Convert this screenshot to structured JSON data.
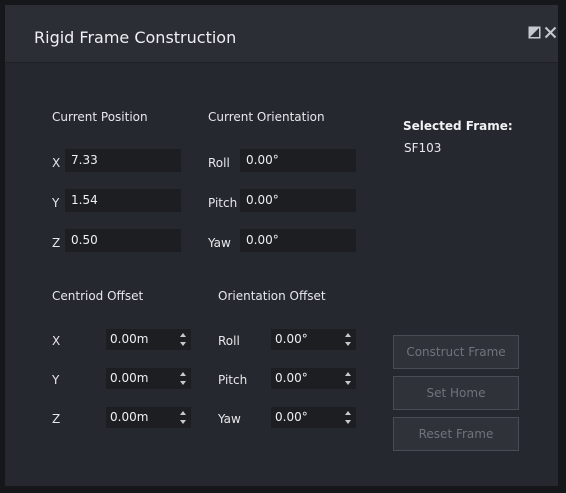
{
  "window": {
    "title": "Rigid Frame Construction",
    "icons": [
      "restore-icon",
      "close-icon"
    ]
  },
  "current_position": {
    "heading": "Current Position",
    "rows": [
      {
        "axis": "X",
        "value": "7.33"
      },
      {
        "axis": "Y",
        "value": "1.54"
      },
      {
        "axis": "Z",
        "value": "0.50"
      }
    ]
  },
  "current_orientation": {
    "heading": "Current Orientation",
    "rows": [
      {
        "axis": "Roll",
        "value": "0.00°"
      },
      {
        "axis": "Pitch",
        "value": "0.00°"
      },
      {
        "axis": "Yaw",
        "value": "0.00°"
      }
    ]
  },
  "selected_frame": {
    "label": "Selected Frame:",
    "value": "SF103"
  },
  "centroid_offset": {
    "heading": "Centriod Offset",
    "rows": [
      {
        "axis": "X",
        "value": "0.00m"
      },
      {
        "axis": "Y",
        "value": "0.00m"
      },
      {
        "axis": "Z",
        "value": "0.00m"
      }
    ]
  },
  "orientation_offset": {
    "heading": "Orientation Offset",
    "rows": [
      {
        "axis": "Roll",
        "value": "0.00°"
      },
      {
        "axis": "Pitch",
        "value": "0.00°"
      },
      {
        "axis": "Yaw",
        "value": "0.00°"
      }
    ]
  },
  "buttons": {
    "construct": "Construct Frame",
    "set_home": "Set Home",
    "reset": "Reset Frame"
  },
  "colors": {
    "background": "#25282e",
    "field": "#1c1e22",
    "disabled_text": "#6f737b"
  }
}
